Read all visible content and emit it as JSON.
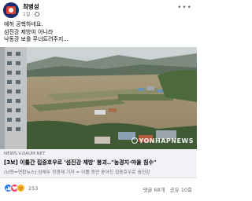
{
  "post": {
    "author": "최병성",
    "time": "1일",
    "more_icon": "more-horizontal-icon",
    "privacy_icon": "globe-icon",
    "text_lines": [
      "예허 공핵하네요.",
      "섬진강 제방이 아니라",
      "낙동강 보를 무너트려주지..."
    ]
  },
  "photo": {
    "description_icon": "flood-photo",
    "watermark": "YONHAPNEWS"
  },
  "link_card": {
    "domain": "NEWS.V.DAUM.NET",
    "title": "[3보] 이틀간 집중호우로 '섬진강 제방' 붕괴..\"농경지·마을 침수\"",
    "description": "(남원=연합뉴스) 임채두 정경재 기자 = 이틀 동안 쏟아진 집중호우로 섬진강"
  },
  "reactions": {
    "count": "253",
    "icons": [
      "like-icon",
      "love-icon",
      "angry-icon"
    ],
    "comments": "댓글 68개",
    "shares": "공유 10회"
  },
  "colors": {
    "like": "#1877f2",
    "love": "#f33e58",
    "angry": "#f7b125",
    "secondary_text": "#65676b",
    "card_bg": "#f0f2f5"
  }
}
